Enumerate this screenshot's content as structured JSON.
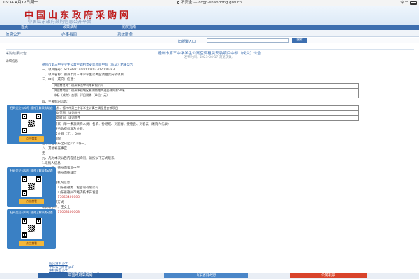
{
  "statusbar": {
    "time": "16:34  4月17日周一",
    "url": "不安全 — ccgp-shandong.gov.cn",
    "signal": "令 ⁹⁸"
  },
  "header": {
    "title": "中国山东政府采购网",
    "subtitle": "中国山东政府采购信息公开平台"
  },
  "nav1": [
    "首页",
    "政策法规",
    "购买指南"
  ],
  "nav2": [
    "信息公开",
    "办事指南",
    "系统服务"
  ],
  "bar3": {
    "mid_link": "旧版聚入口",
    "search_btn": "搜索"
  },
  "breadcrumb": "采购结果公告",
  "doc": {
    "title": "德州市第三中学学生公寓空调租赁安装项目中标（成交）公告",
    "meta": "发布时间：2023-04-17   浏览次数：",
    "flag": "详细信息"
  },
  "lines": [
    {
      "t": "德州市第三中学学生公寓空调租赁安装项目中标（成交）结果公告",
      "c": "blue"
    },
    {
      "t": "一、项目编号：SDGP371400000202302000283",
      "c": ""
    },
    {
      "t": "二、项目名称：德州市第三中学学生公寓空调租赁安装项目",
      "c": ""
    },
    {
      "t": "三、中标（成交）信息：",
      "c": ""
    }
  ],
  "table1": [
    [
      "供应商名称：德州市浩宇机电有限公司"
    ],
    [
      "供应商地址：德州市德城区新湖南路大道西侧向东50米"
    ],
    [
      "中标（成交）金额：详见附件（单位：元）"
    ]
  ],
  "lines2": [
    {
      "t": "四、主要标的信息：",
      "c": ""
    }
  ],
  "table2": [
    [
      "名称：德州市第三中学学生公寓空调租赁安装项目"
    ],
    [
      "服务范围：详见附件"
    ],
    [
      "服务时间：详见附件"
    ]
  ],
  "lines3": [
    {
      "t": "五、评审专家（单一来源采购人员）名单：孙继成、刘迎春、姜德良、刘春云（采购人代表）",
      "c": ""
    },
    {
      "t": "六、代理服务收费标准及金额：",
      "c": ""
    },
    {
      "t": "    收费标准及金额（元）：000",
      "c": ""
    },
    {
      "t": "七、公告期限",
      "c": ""
    },
    {
      "t": "    自本公告发布之日起1个工作日。",
      "c": ""
    },
    {
      "t": "八、其他补充事宜",
      "c": ""
    },
    {
      "t": "    无",
      "c": ""
    },
    {
      "t": "九、凡对本次公告内容提出询问，请按以下方式联系。",
      "c": ""
    },
    {
      "t": "    1.采购人信息",
      "c": ""
    },
    {
      "t": "    名　　称：德州市第三中学",
      "c": ""
    },
    {
      "t": "    地　　址：德州市德城区",
      "c": ""
    },
    {
      "t": "    联系方式：",
      "c": ""
    },
    {
      "t": "    2.采购代理机构信息",
      "c": ""
    },
    {
      "t": "    名　　称：山东省德源工程咨询有限公司",
      "c": ""
    },
    {
      "t": "    地　　址：山东省德州市经济技术开发区",
      "c": ""
    },
    {
      "t": "    联系方式：17053400003",
      "c": "red"
    },
    {
      "t": "    3.项目联系方式",
      "c": ""
    },
    {
      "t": "    项目联系人：王女士",
      "c": ""
    },
    {
      "t": "    电　　话：17053400003",
      "c": "red"
    },
    {
      "t": "十、附件",
      "c": ""
    }
  ],
  "footer_links": [
    "成交清单.pdf",
    "中标公告附件.pdf",
    "评标报告.pdf",
    "德州市第三中学采购结果确认书.pdf"
  ],
  "notes": [
    "1. 德州市第三中学学生公寓空调租赁安装项目中标公告",
    "2. 德州市第三中学学生公寓空调租赁安装项目（成交）公告"
  ],
  "sidead": {
    "head": "扫码关注公众号\n随时了解采购动态",
    "btn": "点击查看"
  },
  "bottombar": [
    "中国政府采购网",
    "山东省财政厅",
    "公务机票"
  ]
}
